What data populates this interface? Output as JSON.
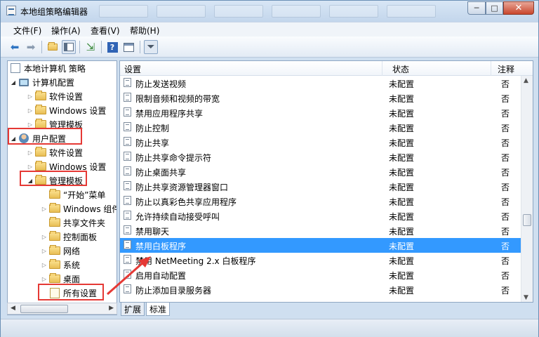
{
  "window": {
    "title": "本地组策略编辑器",
    "min": "─",
    "max": "□",
    "close": "✕"
  },
  "menu": [
    "文件(F)",
    "操作(A)",
    "查看(V)",
    "帮助(H)"
  ],
  "toolbar": {
    "back_icon": "back-arrow-icon",
    "forward_icon": "forward-arrow-icon",
    "help_glyph": "?"
  },
  "tree": {
    "root": "本地计算机 策略",
    "computer_config": "计算机配置",
    "cc_software": "软件设置",
    "cc_windows": "Windows 设置",
    "cc_admin": "管理模板",
    "user_config": "用户配置",
    "uc_software": "软件设置",
    "uc_windows": "Windows 设置",
    "uc_admin": "管理模板",
    "start_menu": "“开始”菜单",
    "windows_components": "Windows 组件",
    "shared_folders": "共享文件夹",
    "control_panel": "控制面板",
    "network": "网络",
    "system": "系统",
    "desktop": "桌面",
    "all_settings": "所有设置"
  },
  "columns": {
    "setting": "设置",
    "state": "状态",
    "comment": "注释"
  },
  "rows": [
    {
      "name": "防止发送视频",
      "state": "未配置",
      "note": "否"
    },
    {
      "name": "限制音频和视频的带宽",
      "state": "未配置",
      "note": "否"
    },
    {
      "name": "禁用应用程序共享",
      "state": "未配置",
      "note": "否"
    },
    {
      "name": "防止控制",
      "state": "未配置",
      "note": "否"
    },
    {
      "name": "防止共享",
      "state": "未配置",
      "note": "否"
    },
    {
      "name": "防止共享命令提示符",
      "state": "未配置",
      "note": "否"
    },
    {
      "name": "防止桌面共享",
      "state": "未配置",
      "note": "否"
    },
    {
      "name": "防止共享资源管理器窗口",
      "state": "未配置",
      "note": "否"
    },
    {
      "name": "防止以真彩色共享应用程序",
      "state": "未配置",
      "note": "否"
    },
    {
      "name": "允许持续自动接受呼叫",
      "state": "未配置",
      "note": "否"
    },
    {
      "name": "禁用聊天",
      "state": "未配置",
      "note": "否"
    },
    {
      "name": "禁用白板程序",
      "state": "未配置",
      "note": "否"
    },
    {
      "name": "禁用 NetMeeting 2.x 白板程序",
      "state": "未配置",
      "note": "否"
    },
    {
      "name": "启用自动配置",
      "state": "未配置",
      "note": "否"
    },
    {
      "name": "防止添加目录服务器",
      "state": "未配置",
      "note": "否"
    }
  ],
  "selected_row": 11,
  "tabs": [
    "扩展",
    "标准"
  ],
  "active_tab": "标准",
  "colors": {
    "selection": "#3399ff",
    "annotation": "#e53935",
    "titlebar": "#c3d6ec"
  }
}
